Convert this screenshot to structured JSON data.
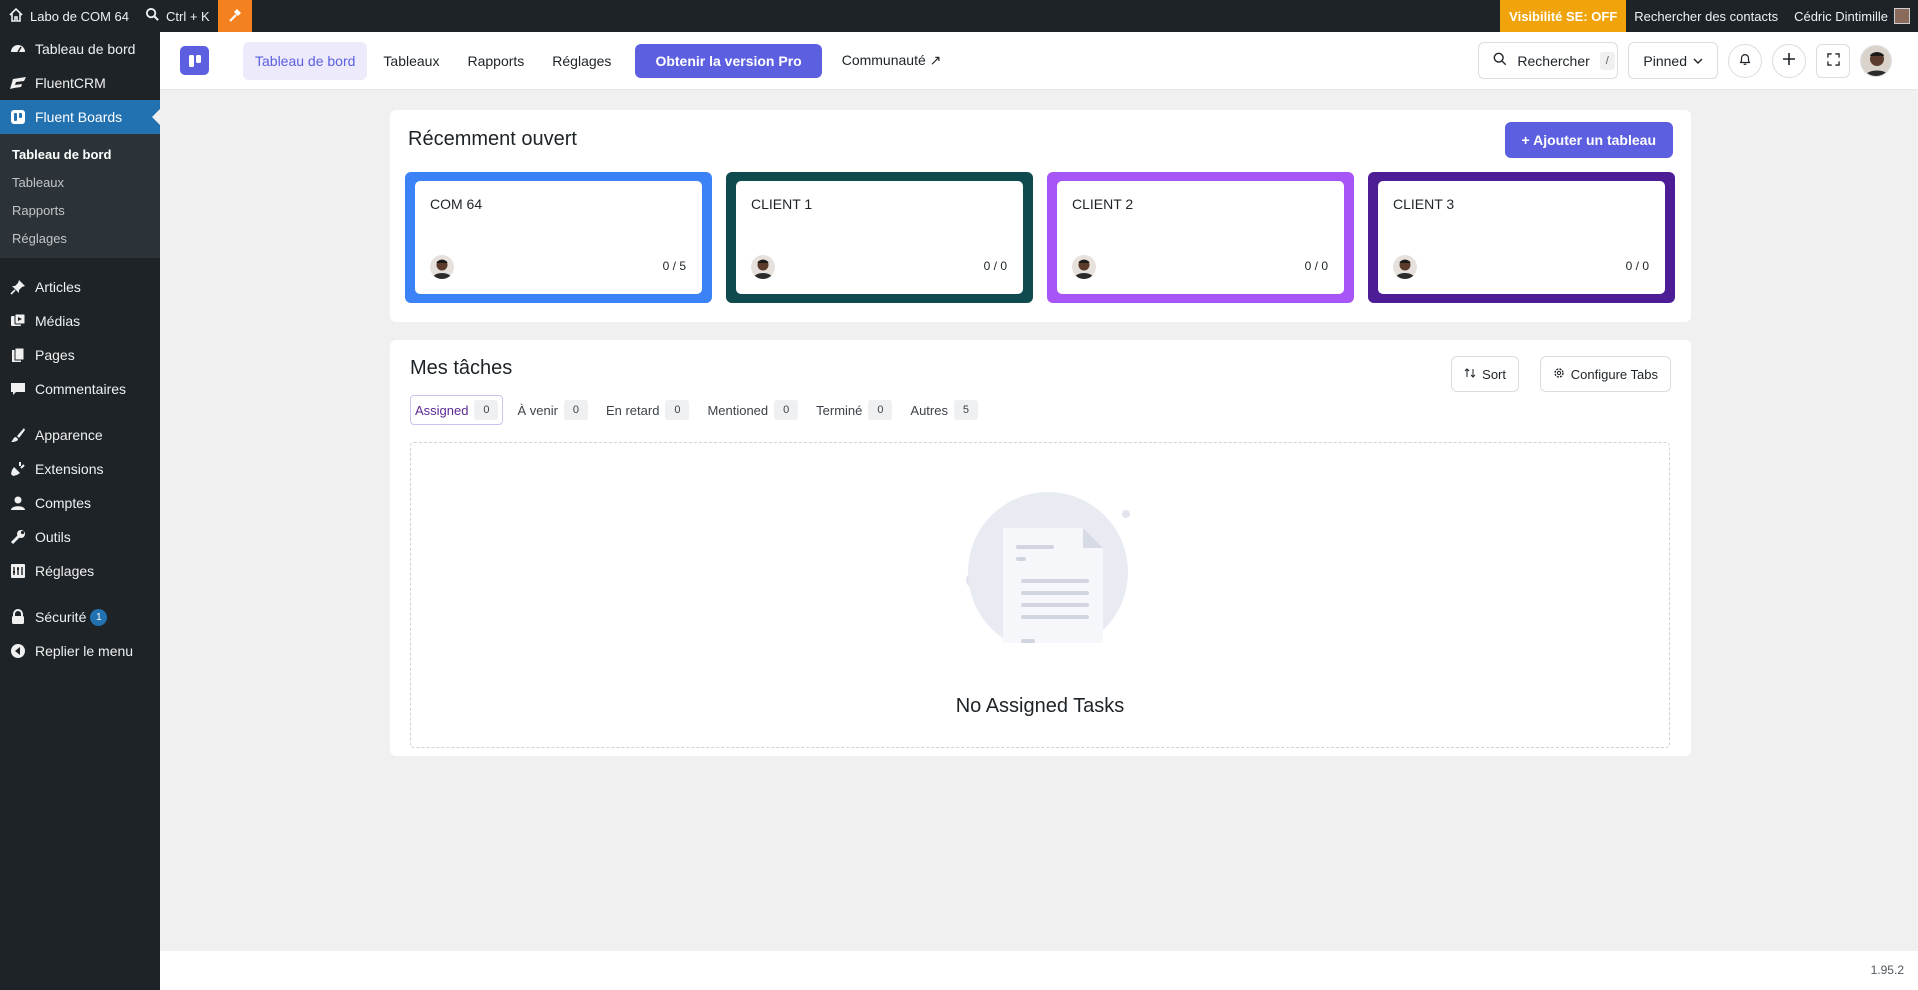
{
  "adminbar": {
    "site_name": "Labo de COM 64",
    "search_shortcut": "Ctrl + K",
    "visibility": "Visibilité SE: OFF",
    "search_contacts": "Rechercher des contacts",
    "user_name": "Cédric Dintimille"
  },
  "sidebar": {
    "items_top": [
      {
        "label": "Tableau de bord",
        "icon": "dashboard-icon"
      },
      {
        "label": "FluentCRM",
        "icon": "fluentcrm-icon"
      },
      {
        "label": "Fluent Boards",
        "icon": "fluent-boards-icon"
      }
    ],
    "submenu": [
      "Tableau de bord",
      "Tableaux",
      "Rapports",
      "Réglages"
    ],
    "items_mid": [
      {
        "label": "Articles",
        "icon": "pin-icon"
      },
      {
        "label": "Médias",
        "icon": "media-icon"
      },
      {
        "label": "Pages",
        "icon": "pages-icon"
      },
      {
        "label": "Commentaires",
        "icon": "comments-icon"
      }
    ],
    "items_bottom": [
      {
        "label": "Apparence",
        "icon": "brush-icon"
      },
      {
        "label": "Extensions",
        "icon": "plugin-icon"
      },
      {
        "label": "Comptes",
        "icon": "user-icon"
      },
      {
        "label": "Outils",
        "icon": "wrench-icon"
      },
      {
        "label": "Réglages",
        "icon": "settings-icon"
      }
    ],
    "security": {
      "label": "Sécurité",
      "badge": "1"
    },
    "collapse": "Replier le menu"
  },
  "topnav": {
    "links": [
      "Tableau de bord",
      "Tableaux",
      "Rapports",
      "Réglages"
    ],
    "pro": "Obtenir la version Pro",
    "community": "Communauté ↗",
    "search": "Rechercher",
    "search_kbd": "/",
    "pinned": "Pinned"
  },
  "recent": {
    "title": "Récemment ouvert",
    "add_button": "+ Ajouter un tableau",
    "boards": [
      {
        "name": "COM 64",
        "count": "0 / 5",
        "color": "#3b82f6"
      },
      {
        "name": "CLIENT 1",
        "count": "0 / 0",
        "color": "#0f4a4f"
      },
      {
        "name": "CLIENT 2",
        "count": "0 / 0",
        "color": "#a855f7"
      },
      {
        "name": "CLIENT 3",
        "count": "0 / 0",
        "color": "#4c1d95"
      }
    ]
  },
  "tasks": {
    "title": "Mes tâches",
    "sort": "Sort",
    "configure": "Configure Tabs",
    "tabs": [
      {
        "label": "Assigned",
        "count": "0"
      },
      {
        "label": "À venir",
        "count": "0"
      },
      {
        "label": "En retard",
        "count": "0"
      },
      {
        "label": "Mentioned",
        "count": "0"
      },
      {
        "label": "Terminé",
        "count": "0"
      },
      {
        "label": "Autres",
        "count": "5"
      }
    ],
    "empty": "No Assigned Tasks"
  },
  "footer": {
    "version": "1.95.2"
  },
  "colors": {
    "accent": "#5b5fe0",
    "wp_blue": "#2271b1",
    "visibility": "#f0a30a"
  }
}
